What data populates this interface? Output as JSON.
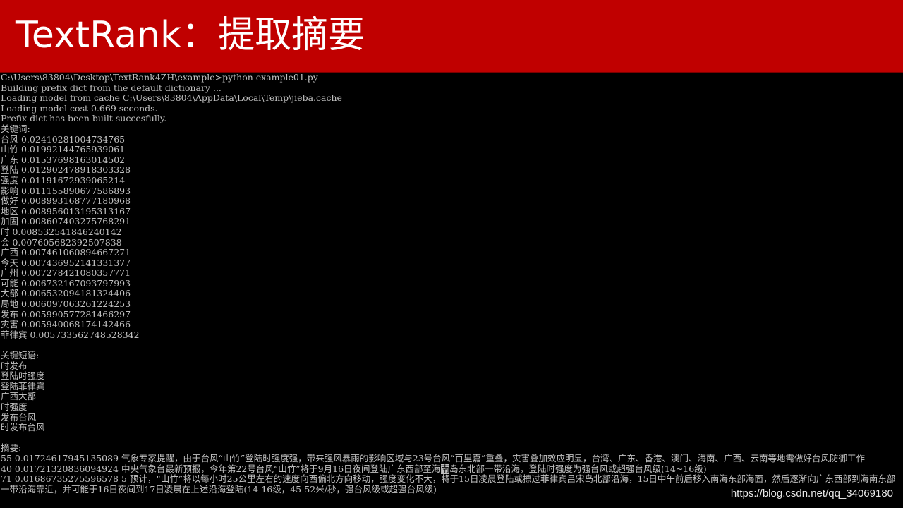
{
  "colors": {
    "banner": "#c00000",
    "banner_text": "#ffffff",
    "console_bg": "#000000",
    "console_text": "#c0c0c0"
  },
  "banner": {
    "title": "TextRank：提取摘要"
  },
  "console": {
    "command_line": "C:\\Users\\83804\\Desktop\\TextRank4ZH\\example>python example01.py",
    "log_lines": [
      "Building prefix dict from the default dictionary ...",
      "Loading model from cache C:\\Users\\83804\\AppData\\Local\\Temp\\jieba.cache",
      "Loading model cost 0.669 seconds.",
      "Prefix dict has been built succesfully."
    ],
    "keywords_header": "关键词:",
    "keywords": [
      "台风 0.02410281004734765",
      "山竹 0.01992144765939061",
      "广东 0.01537698163014502",
      "登陆 0.012902478918303328",
      "强度 0.01191672939065214",
      "影响 0.011155890677586893",
      "做好 0.008993168777180968",
      "地区 0.008956013195313167",
      "加固 0.008607403275768291",
      "时 0.008532541846240142",
      "会 0.007605682392507838",
      "广西 0.007461060894667271",
      "今天 0.007436952141331377",
      "广州 0.007278421080357771",
      "可能 0.006732167093797993",
      "大部 0.006532094181324406",
      "局地 0.006097063261224253",
      "发布 0.005990577281466297",
      "灾害 0.005940068174142466",
      "菲律宾 0.005733562748528342"
    ],
    "phrases_header": "关键短语:",
    "phrases": [
      "时发布",
      "登陆时强度",
      "登陆菲律宾",
      "广西大部",
      "时强度",
      "发布台风",
      "时发布台风"
    ],
    "summary_header": "摘要:",
    "summary_1": "55 0.01724617945135089 气象专家提醒，由于台风“山竹”登陆时强度强，带来强风暴雨的影响区域与23号台风“百里嘉”重叠，灾害叠加效应明显，台湾、广东、香港、澳门、海南、广西、云南等地需做好台风防御工作",
    "summary_2_before_cursor": "40 0.01721320836094924 中央气象台最新预报，今年第22号台风“山竹”将于9月16日夜间登陆广东西部至海",
    "summary_2_cursor": "南",
    "summary_2_after_cursor": "岛东北部一带沿海，登陆时强度为强台风或超强台风级(14~16级)",
    "summary_3": "71 0.01686735275596578 5 预计，“山竹”将以每小时25公里左右的速度向西偏北方向移动，强度变化不大，将于15日凌晨登陆或擦过菲律宾吕宋岛北部沿海，15日中午前后移入南海东部海面，然后逐渐向广东西部到海南东部一带沿海靠近，并可能于16日夜间到17日凌晨在上述沿海登陆(14-16级，45-52米/秒，强台风级或超强台风级)"
  },
  "watermark": "https://blog.csdn.net/qq_34069180"
}
